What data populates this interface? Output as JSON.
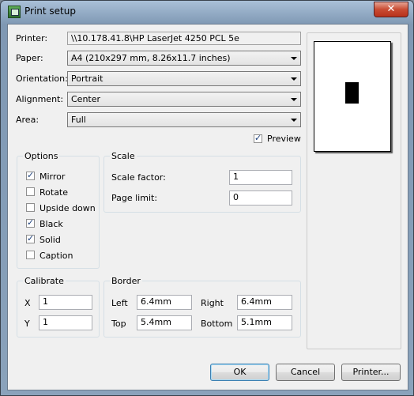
{
  "window": {
    "title": "Print setup",
    "close_glyph": "✕"
  },
  "form": {
    "printer_label": "Printer:",
    "printer_value": "\\\\10.178.41.8\\HP LaserJet 4250 PCL 5e",
    "paper_label": "Paper:",
    "paper_value": "A4 (210x297 mm, 8.26x11.7 inches)",
    "orientation_label": "Orientation:",
    "orientation_value": "Portrait",
    "alignment_label": "Alignment:",
    "alignment_value": "Center",
    "area_label": "Area:",
    "area_value": "Full",
    "preview_label": "Preview",
    "preview_checked": true
  },
  "options": {
    "title": "Options",
    "items": [
      {
        "label": "Mirror",
        "checked": true
      },
      {
        "label": "Rotate",
        "checked": false
      },
      {
        "label": "Upside down",
        "checked": false
      },
      {
        "label": "Black",
        "checked": true
      },
      {
        "label": "Solid",
        "checked": true
      },
      {
        "label": "Caption",
        "checked": false
      }
    ]
  },
  "scale": {
    "title": "Scale",
    "factor_label": "Scale factor:",
    "factor_value": "1",
    "limit_label": "Page limit:",
    "limit_value": "0"
  },
  "calibrate": {
    "title": "Calibrate",
    "x_label": "X",
    "x_value": "1",
    "y_label": "Y",
    "y_value": "1"
  },
  "border": {
    "title": "Border",
    "left_label": "Left",
    "left_value": "6.4mm",
    "right_label": "Right",
    "right_value": "6.4mm",
    "top_label": "Top",
    "top_value": "5.4mm",
    "bottom_label": "Bottom",
    "bottom_value": "5.1mm"
  },
  "buttons": {
    "ok": "OK",
    "cancel": "Cancel",
    "printer": "Printer..."
  }
}
